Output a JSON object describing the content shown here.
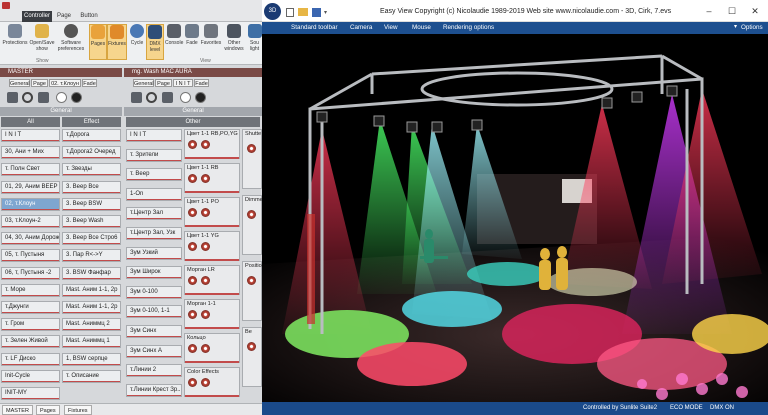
{
  "controller": {
    "tabs": [
      "Controller",
      "Page",
      "Button"
    ],
    "ribbon_buttons": [
      {
        "label": "Protections",
        "icon": "shield-icon"
      },
      {
        "label": "Open/Save show",
        "icon": "folder-icon"
      },
      {
        "label": "Software preferences",
        "icon": "gear-icon"
      },
      {
        "label": "Pages",
        "icon": "pages-icon"
      },
      {
        "label": "Fixtures",
        "icon": "fixtures-icon"
      },
      {
        "label": "Cycle",
        "icon": "cycle-icon"
      },
      {
        "label": "DMX level",
        "icon": "dmx-icon"
      },
      {
        "label": "Console",
        "icon": "console-icon"
      },
      {
        "label": "Fade",
        "icon": "fade-icon"
      },
      {
        "label": "Favorites",
        "icon": "star-icon"
      },
      {
        "label": "Other windows",
        "icon": "windows-icon"
      },
      {
        "label": "Sou light",
        "icon": "light-icon"
      }
    ],
    "ribbon_groups": [
      "Show",
      "View"
    ],
    "master_panel": {
      "title": "MASTER",
      "subtabs": [
        "General",
        "Page",
        "02. т.Клоун",
        "Fade"
      ],
      "section": "General",
      "col_headers": [
        "All",
        "Effect"
      ],
      "col1": [
        "I N I T",
        "30, Ани + Мих",
        "т. Полн Свет",
        "01, 29, Аним ВЕЕР",
        "02, т.Клоун",
        "03, т.Клоун-2",
        "04, 30, Аним Дорож",
        "05, т. Пустыня",
        "06, т, Пустыня -2",
        "т. Море",
        "т.Джунги",
        "т. Гром",
        "т. Зелен Живой",
        "т. LF Диско",
        "Init-Cycle",
        "INIT-MY"
      ],
      "col2": [
        "т.Дорога",
        "т.Дорога2 Очеред",
        "т. Звезды",
        "3. Веер Все",
        "3. Веер BSW",
        "3. Веер Wash",
        "3. Веер Все Стро6",
        "3. Пар R<->Y",
        "3. BSW Фанфар",
        "Mast. Аним 1-1, 2р",
        "Mast. Аним 1-1, 2р",
        "Mast. Аниммц 2",
        "Mast. Аниммц 1",
        "1, BSW серпце",
        "т. Описание"
      ],
      "col1_selected": 4
    },
    "fixture_panel": {
      "title": "mg. Wash MAC AURA",
      "subtabs": [
        "General",
        "Page",
        "I N I T",
        "Fade"
      ],
      "section": "General",
      "col_header": "Other",
      "col1": [
        "I N I T",
        "т. Зрители",
        "т. Веер",
        "1-On",
        "т.Центр Зал",
        "т.Центр Зал, Узк",
        "Зум Узкий",
        "Зум Широк",
        "Зум 0-100",
        "Зум 0-100, 1-1",
        "Зум Синх",
        "Зум Синх А",
        "т.Линии 2",
        "т.Линии Крест Зр..."
      ],
      "col2": [
        "Цвет 1-1 RB,PO,YG",
        "Цвет 1-1 RB",
        "Цвет 1-1 PO",
        "Цвет 1-1 YG",
        "Морган LR",
        "Морган 1-1",
        "Кольцо",
        "Color Effects"
      ],
      "col3": [
        "Shutte",
        "Dimme",
        "Positio",
        "Be"
      ]
    },
    "status_tabs": [
      "MASTER",
      "Pages",
      "Fixtures"
    ]
  },
  "easyview": {
    "title": "Easy View   Copyright (c) Nicolaudie 1989-2019   Web site www.nicolaudie.com - 3D, Cirk, 7.evs",
    "menu": [
      "Standard toolbar",
      "Camera",
      "View",
      "Mouse",
      "Rendering options"
    ],
    "options_label": "Options",
    "status": [
      "Controlled by Sunlite Suite2",
      "ECO MODE",
      "DMX ON"
    ]
  },
  "colors": {
    "menu_blue": "#1d4f8f",
    "cue_bar": "#c24b4b",
    "selected_cue": "#7ea6d0",
    "panel_header": "#7a4a46"
  }
}
